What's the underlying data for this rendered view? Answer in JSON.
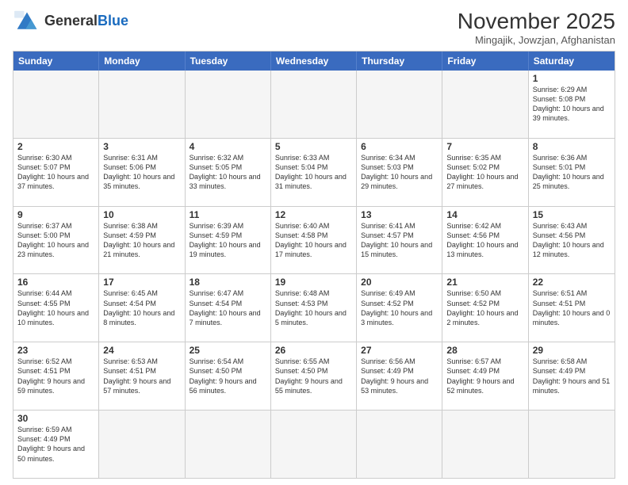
{
  "logo": {
    "text_normal": "General",
    "text_bold": "Blue"
  },
  "title": "November 2025",
  "subtitle": "Mingajik, Jowzjan, Afghanistan",
  "header_days": [
    "Sunday",
    "Monday",
    "Tuesday",
    "Wednesday",
    "Thursday",
    "Friday",
    "Saturday"
  ],
  "weeks": [
    [
      {
        "day": "",
        "info": "",
        "empty": true
      },
      {
        "day": "",
        "info": "",
        "empty": true
      },
      {
        "day": "",
        "info": "",
        "empty": true
      },
      {
        "day": "",
        "info": "",
        "empty": true
      },
      {
        "day": "",
        "info": "",
        "empty": true
      },
      {
        "day": "",
        "info": "",
        "empty": true
      },
      {
        "day": "1",
        "info": "Sunrise: 6:29 AM\nSunset: 5:08 PM\nDaylight: 10 hours and 39 minutes."
      }
    ],
    [
      {
        "day": "2",
        "info": "Sunrise: 6:30 AM\nSunset: 5:07 PM\nDaylight: 10 hours and 37 minutes."
      },
      {
        "day": "3",
        "info": "Sunrise: 6:31 AM\nSunset: 5:06 PM\nDaylight: 10 hours and 35 minutes."
      },
      {
        "day": "4",
        "info": "Sunrise: 6:32 AM\nSunset: 5:05 PM\nDaylight: 10 hours and 33 minutes."
      },
      {
        "day": "5",
        "info": "Sunrise: 6:33 AM\nSunset: 5:04 PM\nDaylight: 10 hours and 31 minutes."
      },
      {
        "day": "6",
        "info": "Sunrise: 6:34 AM\nSunset: 5:03 PM\nDaylight: 10 hours and 29 minutes."
      },
      {
        "day": "7",
        "info": "Sunrise: 6:35 AM\nSunset: 5:02 PM\nDaylight: 10 hours and 27 minutes."
      },
      {
        "day": "8",
        "info": "Sunrise: 6:36 AM\nSunset: 5:01 PM\nDaylight: 10 hours and 25 minutes."
      }
    ],
    [
      {
        "day": "9",
        "info": "Sunrise: 6:37 AM\nSunset: 5:00 PM\nDaylight: 10 hours and 23 minutes."
      },
      {
        "day": "10",
        "info": "Sunrise: 6:38 AM\nSunset: 4:59 PM\nDaylight: 10 hours and 21 minutes."
      },
      {
        "day": "11",
        "info": "Sunrise: 6:39 AM\nSunset: 4:59 PM\nDaylight: 10 hours and 19 minutes."
      },
      {
        "day": "12",
        "info": "Sunrise: 6:40 AM\nSunset: 4:58 PM\nDaylight: 10 hours and 17 minutes."
      },
      {
        "day": "13",
        "info": "Sunrise: 6:41 AM\nSunset: 4:57 PM\nDaylight: 10 hours and 15 minutes."
      },
      {
        "day": "14",
        "info": "Sunrise: 6:42 AM\nSunset: 4:56 PM\nDaylight: 10 hours and 13 minutes."
      },
      {
        "day": "15",
        "info": "Sunrise: 6:43 AM\nSunset: 4:56 PM\nDaylight: 10 hours and 12 minutes."
      }
    ],
    [
      {
        "day": "16",
        "info": "Sunrise: 6:44 AM\nSunset: 4:55 PM\nDaylight: 10 hours and 10 minutes."
      },
      {
        "day": "17",
        "info": "Sunrise: 6:45 AM\nSunset: 4:54 PM\nDaylight: 10 hours and 8 minutes."
      },
      {
        "day": "18",
        "info": "Sunrise: 6:47 AM\nSunset: 4:54 PM\nDaylight: 10 hours and 7 minutes."
      },
      {
        "day": "19",
        "info": "Sunrise: 6:48 AM\nSunset: 4:53 PM\nDaylight: 10 hours and 5 minutes."
      },
      {
        "day": "20",
        "info": "Sunrise: 6:49 AM\nSunset: 4:52 PM\nDaylight: 10 hours and 3 minutes."
      },
      {
        "day": "21",
        "info": "Sunrise: 6:50 AM\nSunset: 4:52 PM\nDaylight: 10 hours and 2 minutes."
      },
      {
        "day": "22",
        "info": "Sunrise: 6:51 AM\nSunset: 4:51 PM\nDaylight: 10 hours and 0 minutes."
      }
    ],
    [
      {
        "day": "23",
        "info": "Sunrise: 6:52 AM\nSunset: 4:51 PM\nDaylight: 9 hours and 59 minutes."
      },
      {
        "day": "24",
        "info": "Sunrise: 6:53 AM\nSunset: 4:51 PM\nDaylight: 9 hours and 57 minutes."
      },
      {
        "day": "25",
        "info": "Sunrise: 6:54 AM\nSunset: 4:50 PM\nDaylight: 9 hours and 56 minutes."
      },
      {
        "day": "26",
        "info": "Sunrise: 6:55 AM\nSunset: 4:50 PM\nDaylight: 9 hours and 55 minutes."
      },
      {
        "day": "27",
        "info": "Sunrise: 6:56 AM\nSunset: 4:49 PM\nDaylight: 9 hours and 53 minutes."
      },
      {
        "day": "28",
        "info": "Sunrise: 6:57 AM\nSunset: 4:49 PM\nDaylight: 9 hours and 52 minutes."
      },
      {
        "day": "29",
        "info": "Sunrise: 6:58 AM\nSunset: 4:49 PM\nDaylight: 9 hours and 51 minutes."
      }
    ],
    [
      {
        "day": "30",
        "info": "Sunrise: 6:59 AM\nSunset: 4:49 PM\nDaylight: 9 hours and 50 minutes."
      },
      {
        "day": "",
        "info": "",
        "empty": true
      },
      {
        "day": "",
        "info": "",
        "empty": true
      },
      {
        "day": "",
        "info": "",
        "empty": true
      },
      {
        "day": "",
        "info": "",
        "empty": true
      },
      {
        "day": "",
        "info": "",
        "empty": true
      },
      {
        "day": "",
        "info": "",
        "empty": true
      }
    ]
  ]
}
